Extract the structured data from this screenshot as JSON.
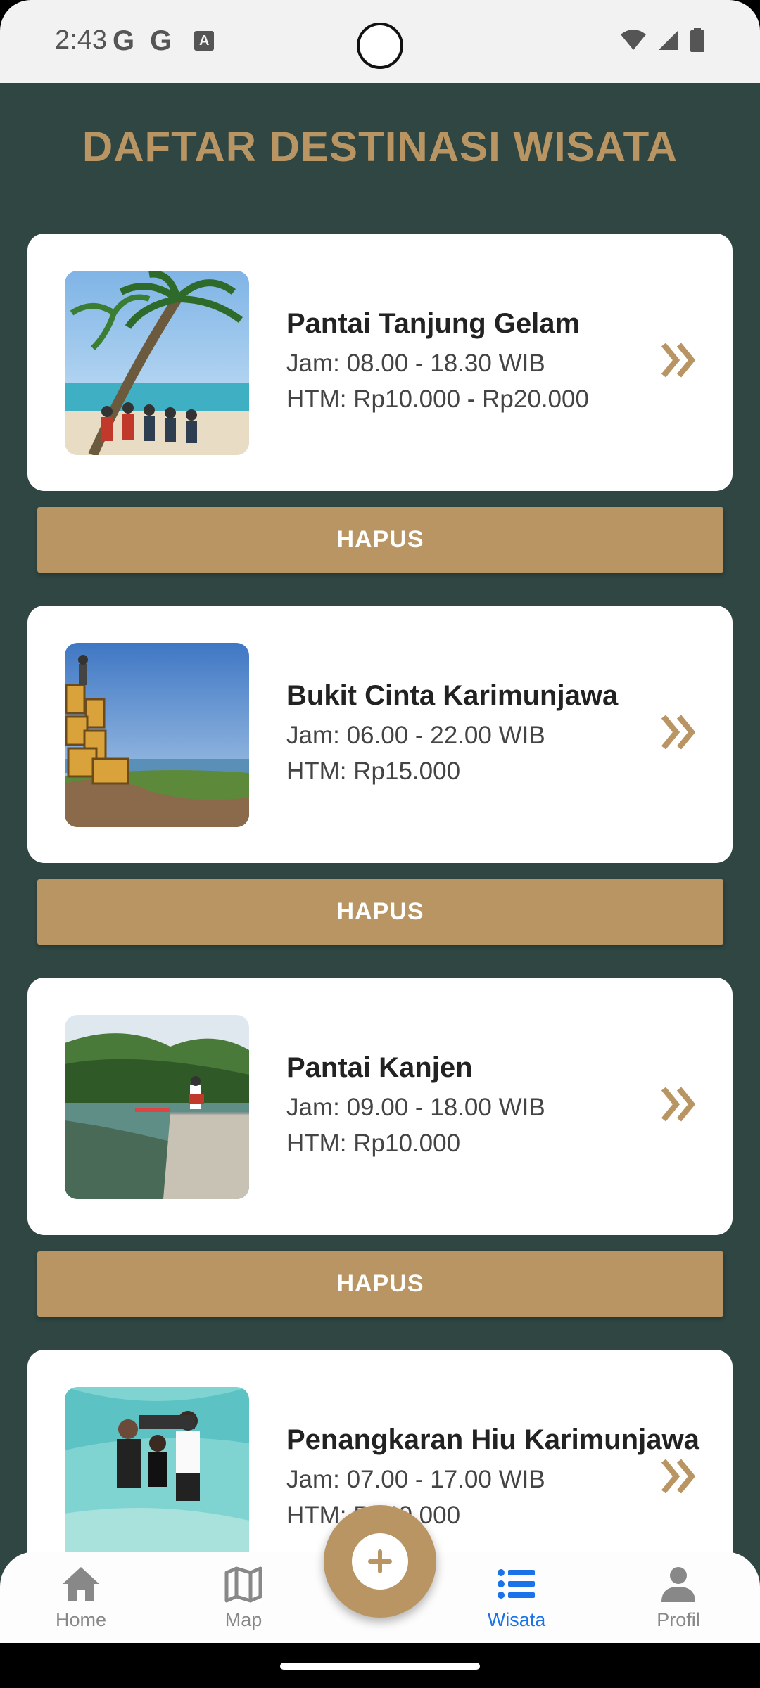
{
  "status_bar": {
    "time": "2:43",
    "left_icons": [
      "G",
      "G",
      "A"
    ]
  },
  "page": {
    "title": "DAFTAR DESTINASI WISATA"
  },
  "destinations": [
    {
      "name": "Pantai Tanjung Gelam",
      "hours": "Jam: 08.00 - 18.30 WIB",
      "price": "HTM: Rp10.000 - Rp20.000",
      "delete_label": "HAPUS"
    },
    {
      "name": "Bukit Cinta Karimunjawa",
      "hours": "Jam: 06.00 - 22.00 WIB",
      "price": "HTM: Rp15.000",
      "delete_label": "HAPUS"
    },
    {
      "name": "Pantai Kanjen",
      "hours": "Jam: 09.00 - 18.00 WIB",
      "price": "HTM: Rp10.000",
      "delete_label": "HAPUS"
    },
    {
      "name": "Penangkaran Hiu Karimunjawa",
      "hours": "Jam: 07.00 - 17.00 WIB",
      "price": "HTM: Rp40.000"
    }
  ],
  "bottom_nav": {
    "items": [
      {
        "label": "Home",
        "icon": "home-icon"
      },
      {
        "label": "Map",
        "icon": "map-icon"
      },
      {
        "label": "Wisata",
        "icon": "list-icon",
        "active": true
      },
      {
        "label": "Profil",
        "icon": "person-icon"
      }
    ],
    "fab_icon": "add-icon"
  },
  "colors": {
    "background": "#2f4643",
    "accent": "#b89562",
    "active_tab": "#1a73e8"
  }
}
